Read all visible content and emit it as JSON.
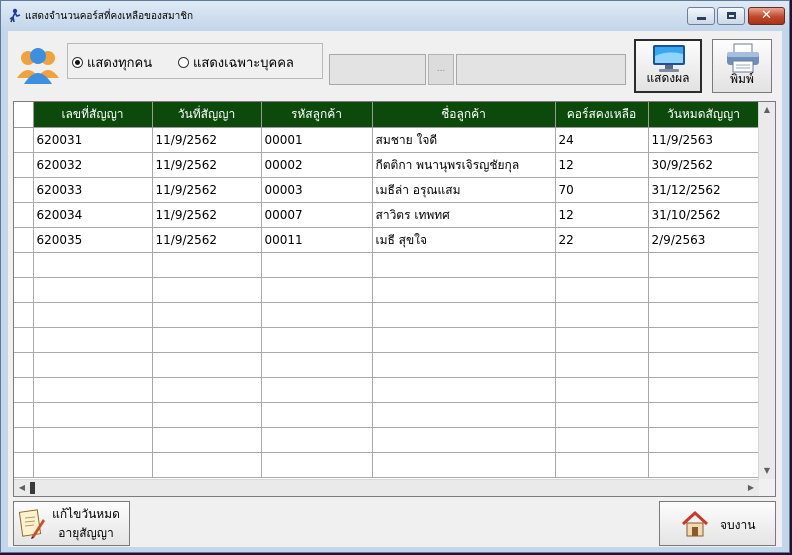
{
  "window": {
    "title": "แสดงจำนวนคอร์สที่คงเหลือของสมาชิก",
    "minimize_icon": "minimize-icon",
    "maximize_icon": "maximize-icon",
    "close_icon": "close-icon",
    "close_glyph": "✕"
  },
  "toolbar": {
    "filter_all_label": "แสดงทุกคน",
    "filter_person_label": "แสดงเฉพาะบุคคล",
    "filter_selected": "all",
    "customer_code_value": "",
    "browse_label": "...",
    "customer_name_value": "",
    "show_label": "แสดงผล",
    "print_label": "พิมพ์"
  },
  "grid": {
    "columns": [
      "เลขที่สัญญา",
      "วันที่สัญญา",
      "รหัสลูกค้า",
      "ชื่อลูกค้า",
      "คอร์สคงเหลือ",
      "วันหมดสัญญา"
    ],
    "rows": [
      [
        "620031",
        "11/9/2562",
        "00001",
        "สมชาย ใจดี",
        "24",
        "11/9/2563"
      ],
      [
        "620032",
        "11/9/2562",
        "00002",
        "กีตติกา พนานุพรเจิรญชัยกุล",
        "12",
        "30/9/2562"
      ],
      [
        "620033",
        "11/9/2562",
        "00003",
        "เมธีล่า อรุณแสม",
        "70",
        "31/12/2562"
      ],
      [
        "620034",
        "11/9/2562",
        "00007",
        "สาวิตร เทพทศ",
        "12",
        "31/10/2562"
      ],
      [
        "620035",
        "11/9/2562",
        "00011",
        "เมธี สุขใจ",
        "22",
        "2/9/2563"
      ]
    ],
    "empty_rows": 9
  },
  "footer": {
    "edit_label_line1": "แก้ไขวันหมด",
    "edit_label_line2": "อายุสัญญา",
    "exit_label": "จบงาน"
  },
  "colors": {
    "header_bg": "#0b4a0b",
    "header_text": "#ffffff",
    "title_bar": "#c4d6ea",
    "close_button": "#c1462a"
  }
}
